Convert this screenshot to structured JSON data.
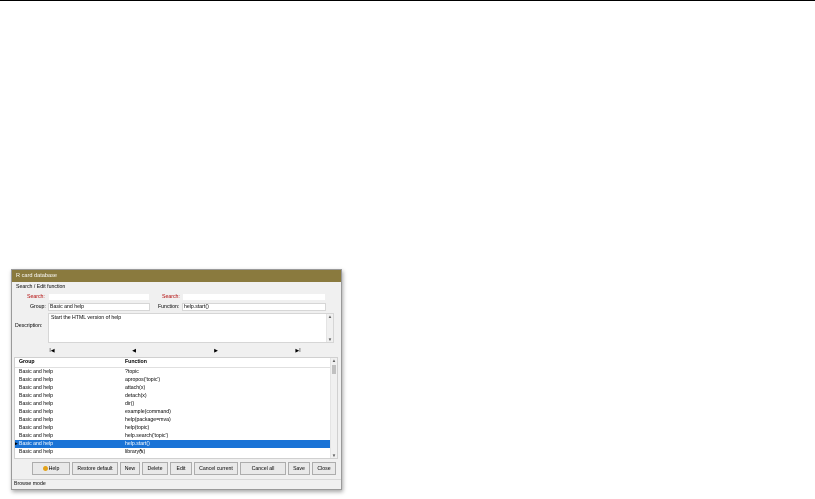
{
  "window": {
    "title": "R card database"
  },
  "search_edit": {
    "legend": "Search / Edit function",
    "search_label_left": "Search:",
    "search_label_right": "Search:",
    "group_label": "Group:",
    "group_value": "Basic and help",
    "function_label": "Function:",
    "function_value": "help.start()",
    "description_label": "Description:",
    "description_value": "Start the HTML version of help"
  },
  "navigator": {
    "first": "I◀",
    "prev": "◀",
    "next": "▶",
    "last": "▶I"
  },
  "grid": {
    "columns": [
      "Group",
      "Function"
    ],
    "rows": [
      {
        "group": "Basic and help",
        "function": "?topic"
      },
      {
        "group": "Basic and help",
        "function": "apropos('topic')"
      },
      {
        "group": "Basic and help",
        "function": "attach(x)"
      },
      {
        "group": "Basic and help",
        "function": "detach(x)"
      },
      {
        "group": "Basic and help",
        "function": "dir()"
      },
      {
        "group": "Basic and help",
        "function": "example(command)"
      },
      {
        "group": "Basic and help",
        "function": "help(package=mva)"
      },
      {
        "group": "Basic and help",
        "function": "help(topic)"
      },
      {
        "group": "Basic and help",
        "function": "help.search('topic')"
      },
      {
        "group": "Basic and help",
        "function": "help.start()"
      },
      {
        "group": "Basic and help",
        "function": "library(x)"
      }
    ],
    "selected_index": 9
  },
  "buttons": {
    "help": "Help",
    "restore_default": "Restore default",
    "new": "New",
    "delete": "Delete",
    "edit": "Edit",
    "cancel_current": "Cancel current",
    "cancel_all": "Cancel all",
    "save": "Save",
    "close": "Close"
  },
  "status": {
    "mode": "Browse mode"
  },
  "colors": {
    "titlebar": "#8a7a3e",
    "selection": "#1a73d6",
    "search_label": "#b00000"
  }
}
